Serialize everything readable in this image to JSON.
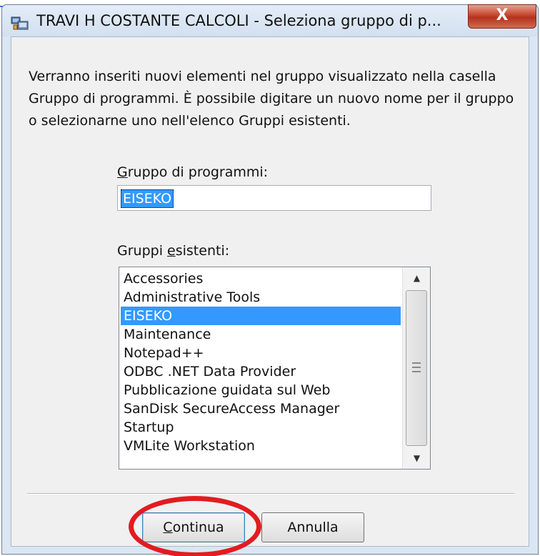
{
  "window": {
    "title": "TRAVI H COSTANTE CALCOLI - Seleziona gruppo di p...",
    "close_label": "X"
  },
  "description": "Verranno inseriti nuovi elementi nel gruppo visualizzato nella casella Gruppo di programmi. È possibile digitare un nuovo nome per il gruppo o selezionarne uno nell'elenco Gruppi esistenti.",
  "program_group": {
    "label_prefix": "G",
    "label_rest": "ruppo di programmi:",
    "value": "EISEKO"
  },
  "existing_groups": {
    "label_prefix": "Gruppi ",
    "label_underline": "e",
    "label_rest": "sistenti:",
    "items": [
      "Accessories",
      "Administrative Tools",
      "EISEKO",
      "Maintenance",
      "Notepad++",
      "ODBC .NET Data Provider",
      "Pubblicazione guidata sul Web",
      "SanDisk SecureAccess Manager",
      "Startup",
      "VMLite Workstation"
    ],
    "selected": "EISEKO"
  },
  "buttons": {
    "continue_underline": "C",
    "continue_rest": "ontinua",
    "cancel_label": "Annulla"
  },
  "colors": {
    "selection": "#3399ff",
    "highlight_ellipse": "#e21c20",
    "close_button": "#c5442b"
  }
}
